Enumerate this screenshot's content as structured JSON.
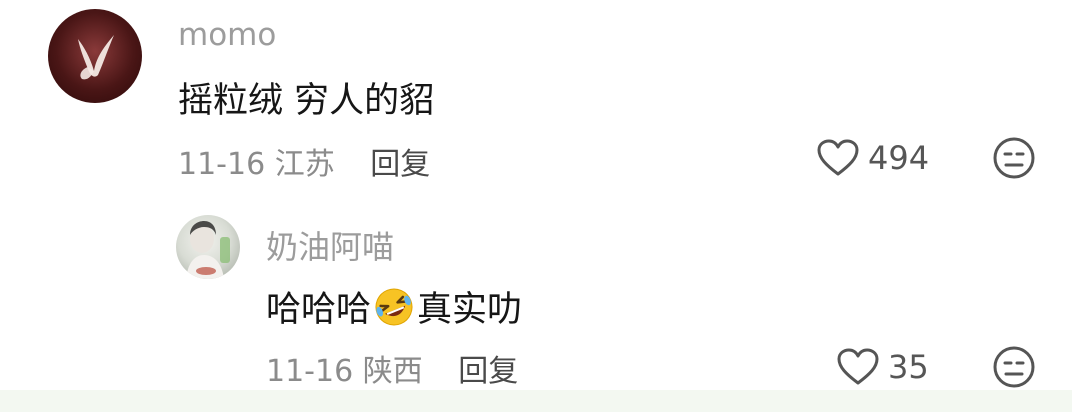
{
  "comments": [
    {
      "username": "momo",
      "content": "摇粒绒 穷人的貂",
      "date": "11-16",
      "location": "江苏",
      "reply_label": "回复",
      "likes": "494",
      "avatar_icon": "butterfly-avatar",
      "like_icon": "heart-outline-icon",
      "dislike_icon": "neutral-face-icon"
    },
    {
      "username": "奶油阿喵",
      "content_before": "哈哈哈",
      "content_emoji": "rolling-laughing-emoji",
      "content_after": "真实叻",
      "date": "11-16",
      "location": "陕西",
      "reply_label": "回复",
      "likes": "35",
      "avatar_icon": "portrait-avatar",
      "like_icon": "heart-outline-icon",
      "dislike_icon": "neutral-face-icon"
    }
  ],
  "colors": {
    "username": "#9c9c9c",
    "meta": "#8b8b8b",
    "text": "#161616"
  }
}
